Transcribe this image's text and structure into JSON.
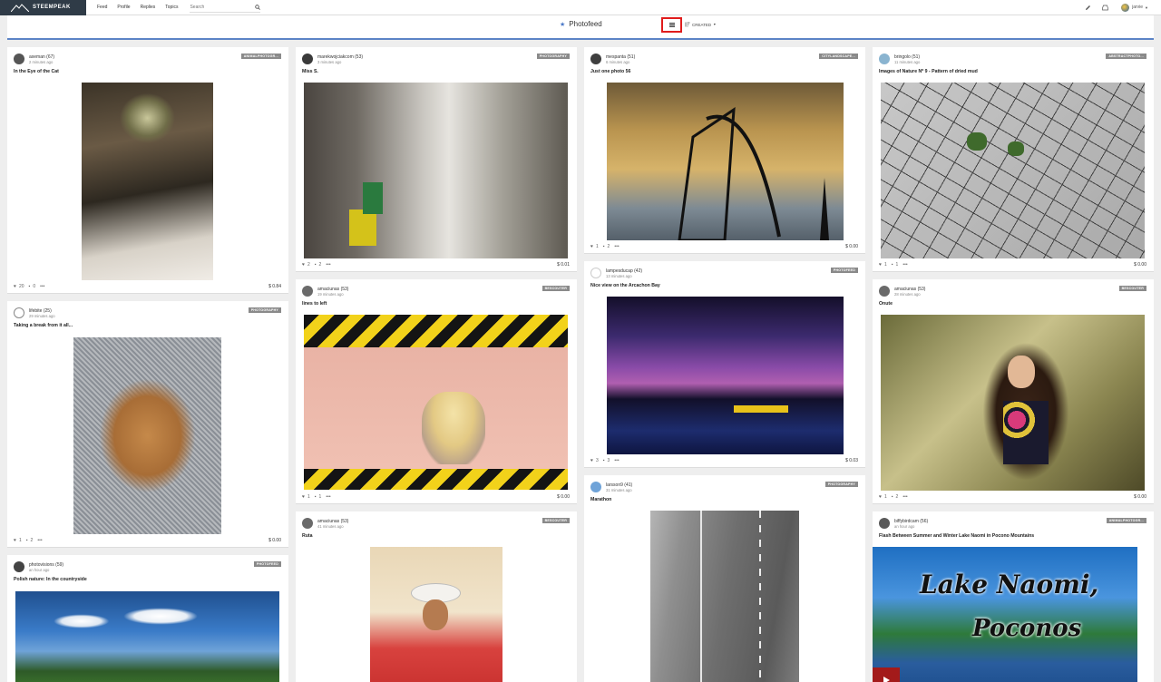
{
  "nav": {
    "brand": "STEEMPEAK",
    "links": [
      "Feed",
      "Profile",
      "Replies",
      "Topics"
    ],
    "search_placeholder": "Search",
    "user": "jarvie"
  },
  "subheader": {
    "title": "Photofeed",
    "sort_label": "CREATED"
  },
  "colors": {
    "accent": "#5c84c6",
    "highlight": "#e01c1c",
    "tag": "#8a8a8a"
  },
  "cards": [
    {
      "author": "axeman (67)",
      "time": "2 minutes ago",
      "tag": "ANIMALPHOTOGR...",
      "title": "In the Eye of the Cat",
      "likes": "20",
      "comments": "0",
      "payout": "$ 0.84"
    },
    {
      "author": "lifebite (25)",
      "time": "29 minutes ago",
      "tag": "PHOTOGRAPHY",
      "title": "Taking a break from it all...",
      "likes": "1",
      "comments": "2",
      "payout": "$ 0.00"
    },
    {
      "author": "photovisions (59)",
      "time": "an hour ago",
      "tag": "PHOTOFEED",
      "title": "Polish nature: In the countryside",
      "likes": "",
      "comments": "",
      "payout": ""
    },
    {
      "author": "marekwojciakcom (53)",
      "time": "3 minutes ago",
      "tag": "PHOTOGRAPHY",
      "title": "Miss S.",
      "likes": "2",
      "comments": "2",
      "payout": "$ 0.01"
    },
    {
      "author": "amaciunas (53)",
      "time": "19 minutes ago",
      "tag": "BESCOUTER",
      "title": "lines to left",
      "likes": "1",
      "comments": "1",
      "payout": "$ 0.00"
    },
    {
      "author": "amaciunas (53)",
      "time": "41 minutes ago",
      "tag": "BESCOUTER",
      "title": "Ruta",
      "likes": "",
      "comments": "",
      "payout": ""
    },
    {
      "author": "mespanta (51)",
      "time": "6 minutes ago",
      "tag": "CITYLANDSCAPE...",
      "title": "Just one photo 56",
      "likes": "1",
      "comments": "2",
      "payout": "$ 0.00"
    },
    {
      "author": "lampesducap (42)",
      "time": "13 minutes ago",
      "tag": "PHOTOFEED",
      "title": "Nice view on the Arcachon Bay",
      "likes": "3",
      "comments": "3",
      "payout": "$ 0.03"
    },
    {
      "author": "larsson9 (41)",
      "time": "31 minutes ago",
      "tag": "PHOTOGRAPHY",
      "title": "Marathon",
      "likes": "",
      "comments": "",
      "payout": ""
    },
    {
      "author": "bringolo (51)",
      "time": "11 minutes ago",
      "tag": "ABSTRACTPHOTO...",
      "title": "Images of Nature Nº 9 - Pattern of dried mud",
      "likes": "1",
      "comments": "1",
      "payout": "$ 0.00"
    },
    {
      "author": "amaciunas (53)",
      "time": "28 minutes ago",
      "tag": "BESCOUTER",
      "title": "Onute",
      "likes": "1",
      "comments": "2",
      "payout": "$ 0.00"
    },
    {
      "author": "biffybirdcam (56)",
      "time": "an hour ago",
      "tag": "ANIMALPHOTOGR...",
      "title": "Flash Between Summer and Winter Lake Naomi in Pocono Mountains",
      "likes": "",
      "comments": "",
      "payout": "",
      "image_text_1": "Lake Naomi,",
      "image_text_2": "Poconos"
    }
  ]
}
